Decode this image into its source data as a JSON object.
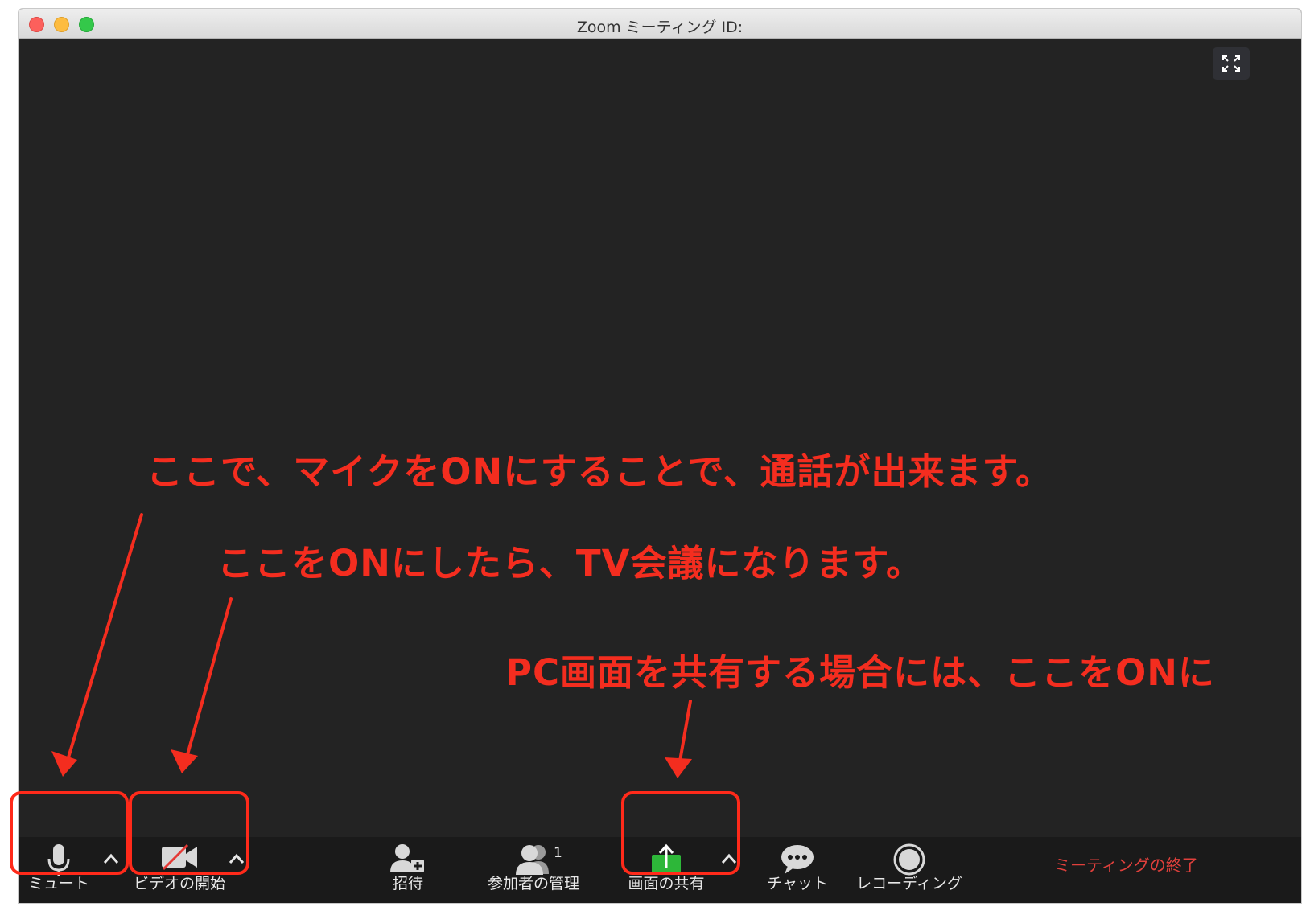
{
  "window": {
    "title": "Zoom ミーティング ID:"
  },
  "toolbar": {
    "mute_label": "ミュート",
    "video_label": "ビデオの開始",
    "invite_label": "招待",
    "participants_label": "参加者の管理",
    "participants_count": "1",
    "share_label": "画面の共有",
    "chat_label": "チャット",
    "record_label": "レコーディング",
    "end_label": "ミーティングの終了"
  },
  "annotations": {
    "mic_note": "ここで、マイクをONにすることで、通話が出来ます。",
    "video_note": "ここをONにしたら、TV会議になります。",
    "share_note": "PC画面を共有する場合には、ここをONに"
  },
  "colors": {
    "annotation": "#f42d1f",
    "share_icon": "#2db739",
    "end_meeting": "#e0403c",
    "background": "#232323"
  }
}
